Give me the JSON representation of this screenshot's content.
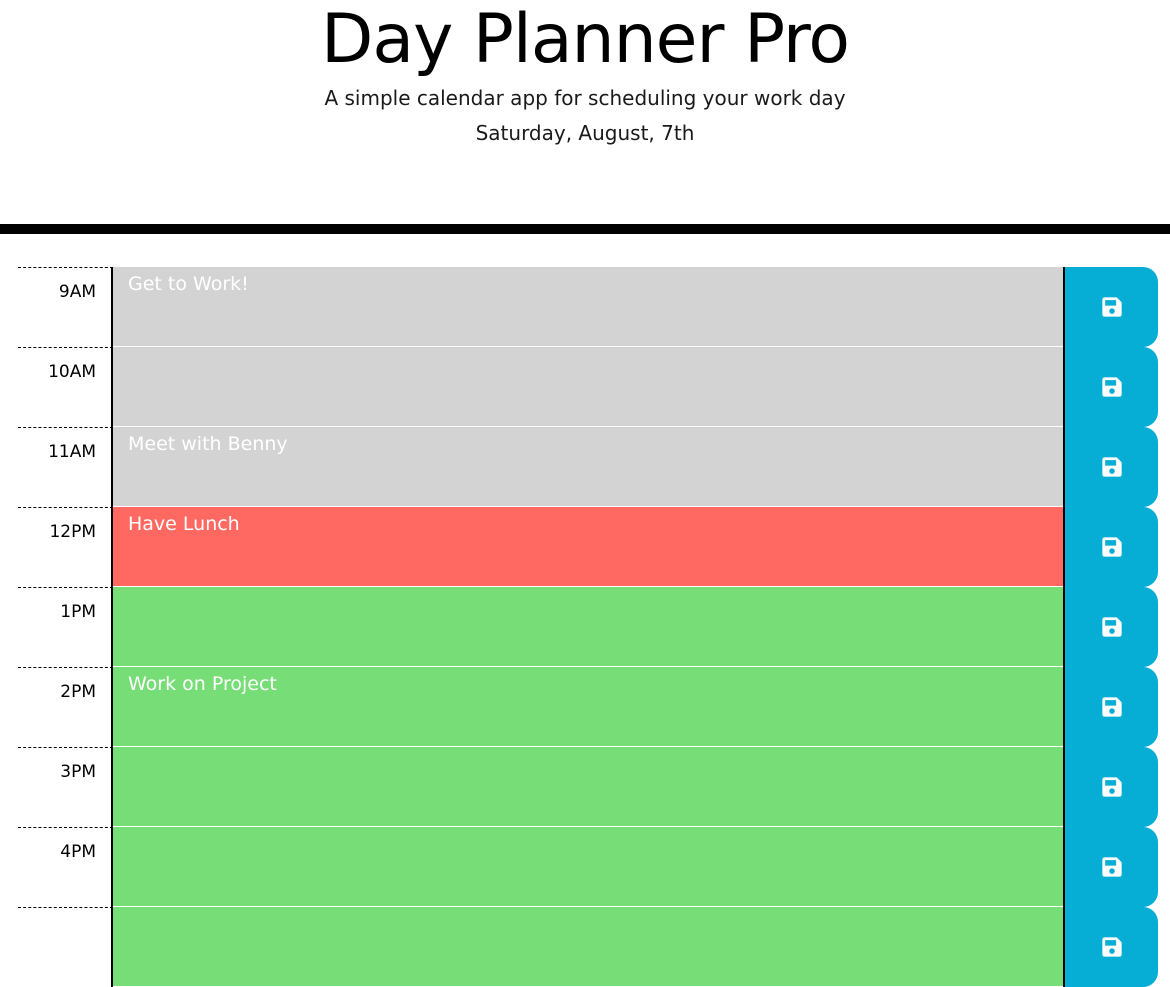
{
  "header": {
    "title": "Day Planner Pro",
    "subtitle": "A simple calendar app for scheduling your work day",
    "date": "Saturday, August, 7th"
  },
  "colors": {
    "past": "#d3d3d3",
    "present": "#ff6961",
    "future": "#77dd77",
    "save_button": "#06aed5"
  },
  "rows": [
    {
      "hour": "9AM",
      "text": "Get to Work!",
      "state": "past",
      "icon": "save-icon"
    },
    {
      "hour": "10AM",
      "text": "",
      "state": "past",
      "icon": "save-icon"
    },
    {
      "hour": "11AM",
      "text": "Meet with Benny",
      "state": "past",
      "icon": "save-icon"
    },
    {
      "hour": "12PM",
      "text": "Have Lunch",
      "state": "present",
      "icon": "save-icon"
    },
    {
      "hour": "1PM",
      "text": "",
      "state": "future",
      "icon": "save-icon"
    },
    {
      "hour": "2PM",
      "text": "Work on Project",
      "state": "future",
      "icon": "save-icon"
    },
    {
      "hour": "3PM",
      "text": "",
      "state": "future",
      "icon": "save-icon"
    },
    {
      "hour": "4PM",
      "text": "",
      "state": "future",
      "icon": "save-icon"
    },
    {
      "hour": "",
      "text": "",
      "state": "future",
      "icon": "save-icon"
    }
  ]
}
